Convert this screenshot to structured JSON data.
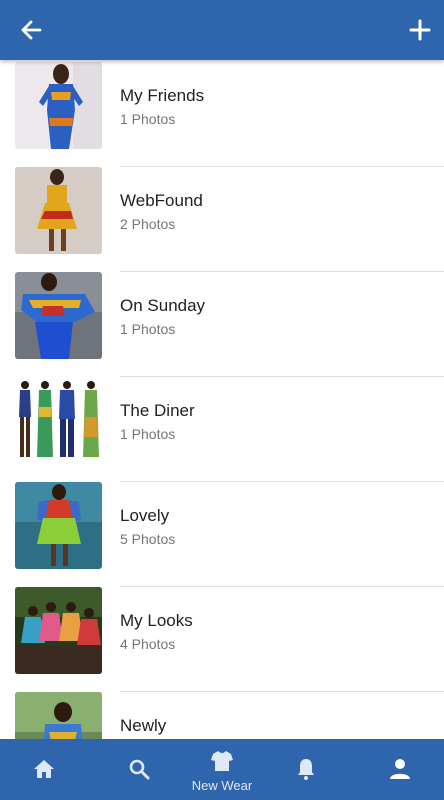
{
  "header": {
    "back_icon": "arrow-left-icon",
    "add_icon": "plus-icon",
    "bar_color": "#2f65ad"
  },
  "albums": [
    {
      "title": "My Friends",
      "count": "1 Photos"
    },
    {
      "title": "WebFound",
      "count": "2 Photos"
    },
    {
      "title": "On Sunday",
      "count": "1 Photos"
    },
    {
      "title": "The Diner",
      "count": "1 Photos"
    },
    {
      "title": "Lovely",
      "count": "5 Photos"
    },
    {
      "title": "My Looks",
      "count": "4 Photos"
    },
    {
      "title": "Newly",
      "count": ""
    }
  ],
  "bottom_nav": {
    "items": [
      {
        "icon": "home-icon",
        "label": ""
      },
      {
        "icon": "search-icon",
        "label": ""
      },
      {
        "icon": "shirt-icon",
        "label": "New Wear"
      },
      {
        "icon": "bell-icon",
        "label": ""
      },
      {
        "icon": "person-icon",
        "label": ""
      }
    ]
  }
}
